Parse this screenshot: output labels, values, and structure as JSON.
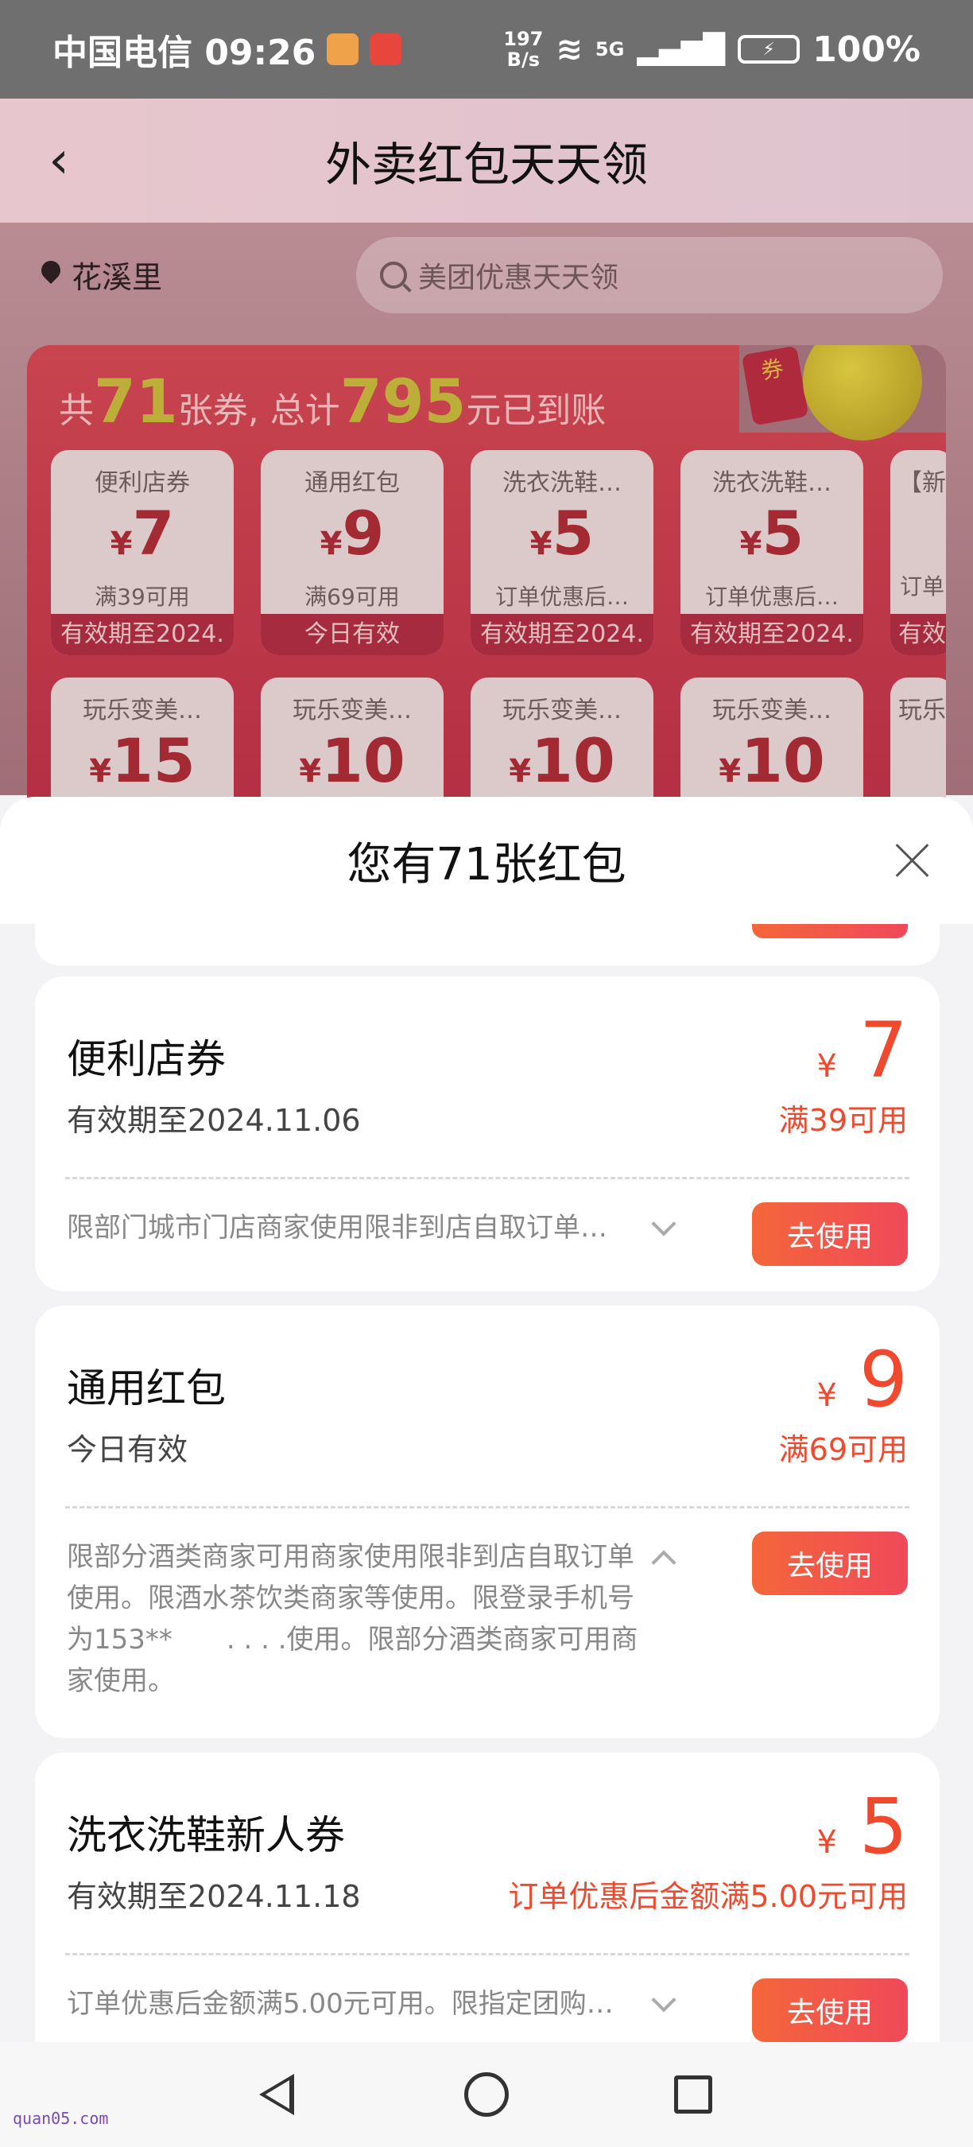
{
  "status_bar": {
    "carrier_time": "中国电信 09:26",
    "net_speed_top": "197",
    "net_speed_bottom": "B/s",
    "network": "5G",
    "battery": "100%"
  },
  "header": {
    "title": "外卖红包天天领"
  },
  "background": {
    "location": "花溪里",
    "search_placeholder": "美团优惠天天领",
    "promo": {
      "prefix": "共",
      "count": "71",
      "mid": "张券, 总计",
      "total": "795",
      "suffix": "元已到账",
      "envelope_label": "券"
    },
    "row1": [
      {
        "title": "便利店券",
        "value": "7",
        "cond": "满39可用",
        "footer": "有效期至2024."
      },
      {
        "title": "通用红包",
        "value": "9",
        "cond": "满69可用",
        "footer": "今日有效"
      },
      {
        "title": "洗衣洗鞋…",
        "value": "5",
        "cond": "订单优惠后…",
        "footer": "有效期至2024."
      },
      {
        "title": "洗衣洗鞋…",
        "value": "5",
        "cond": "订单优惠后…",
        "footer": "有效期至2024."
      },
      {
        "title": "【新",
        "value": "",
        "cond": "订单",
        "footer": "有效"
      }
    ],
    "row2": [
      {
        "title": "玩乐变美…",
        "value": "15"
      },
      {
        "title": "玩乐变美…",
        "value": "10"
      },
      {
        "title": "玩乐变美…",
        "value": "10"
      },
      {
        "title": "玩乐变美…",
        "value": "10"
      },
      {
        "title": "玩乐",
        "value": ""
      }
    ],
    "currency": "¥"
  },
  "sheet": {
    "title": "您有71张红包",
    "cards": [
      {
        "name": "便利店券",
        "valid": "有效期至2024.11.06",
        "currency": "¥",
        "amount": "7",
        "condition": "满39可用",
        "desc": "限部门城市门店商家使用限非到店自取订单…",
        "button": "去使用"
      },
      {
        "name": "通用红包",
        "valid": "今日有效",
        "currency": "¥",
        "amount": "9",
        "condition": "满69可用",
        "desc": "限部分酒类商家可用商家使用限非到店自取订单使用。限酒水茶饮类商家等使用。限登录手机号为153**　　. . . .使用。限部分酒类商家可用商家使用。",
        "button": "去使用"
      },
      {
        "name": "洗衣洗鞋新人券",
        "valid": "有效期至2024.11.18",
        "currency": "¥",
        "amount": "5",
        "condition": "订单优惠后金额满5.00元可用",
        "desc": "订单优惠后金额满5.00元可用。限指定团购…",
        "button": "去使用"
      }
    ]
  },
  "watermark": "quan05.com"
}
